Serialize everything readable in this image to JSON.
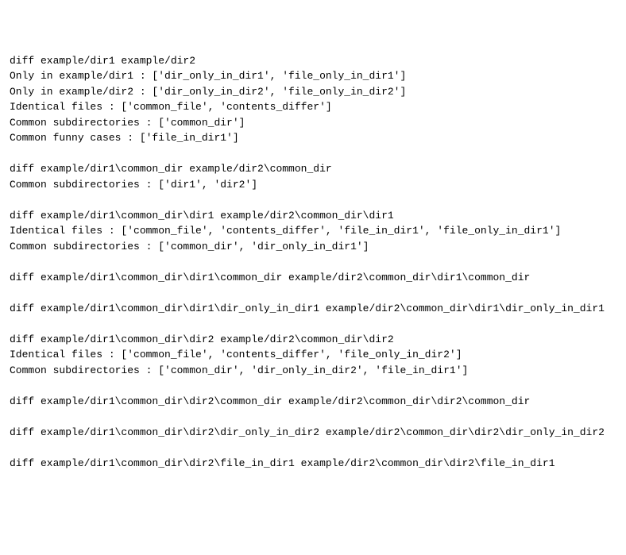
{
  "lines": [
    "diff example/dir1 example/dir2",
    "Only in example/dir1 : ['dir_only_in_dir1', 'file_only_in_dir1']",
    "Only in example/dir2 : ['dir_only_in_dir2', 'file_only_in_dir2']",
    "Identical files : ['common_file', 'contents_differ']",
    "Common subdirectories : ['common_dir']",
    "Common funny cases : ['file_in_dir1']",
    "",
    "diff example/dir1\\common_dir example/dir2\\common_dir",
    "Common subdirectories : ['dir1', 'dir2']",
    "",
    "diff example/dir1\\common_dir\\dir1 example/dir2\\common_dir\\dir1",
    "Identical files : ['common_file', 'contents_differ', 'file_in_dir1', 'file_only_in_dir1']",
    "Common subdirectories : ['common_dir', 'dir_only_in_dir1']",
    "",
    "diff example/dir1\\common_dir\\dir1\\common_dir example/dir2\\common_dir\\dir1\\common_dir",
    "",
    "diff example/dir1\\common_dir\\dir1\\dir_only_in_dir1 example/dir2\\common_dir\\dir1\\dir_only_in_dir1",
    "",
    "diff example/dir1\\common_dir\\dir2 example/dir2\\common_dir\\dir2",
    "Identical files : ['common_file', 'contents_differ', 'file_only_in_dir2']",
    "Common subdirectories : ['common_dir', 'dir_only_in_dir2', 'file_in_dir1']",
    "",
    "diff example/dir1\\common_dir\\dir2\\common_dir example/dir2\\common_dir\\dir2\\common_dir",
    "",
    "diff example/dir1\\common_dir\\dir2\\dir_only_in_dir2 example/dir2\\common_dir\\dir2\\dir_only_in_dir2",
    "",
    "diff example/dir1\\common_dir\\dir2\\file_in_dir1 example/dir2\\common_dir\\dir2\\file_in_dir1"
  ]
}
